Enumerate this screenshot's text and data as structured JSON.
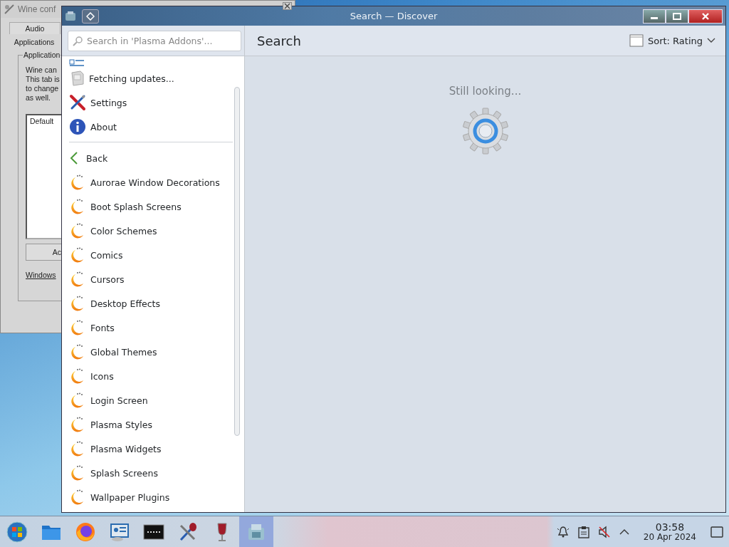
{
  "wine_window": {
    "title": "Wine conf",
    "tabs": [
      {
        "label": "Audio",
        "selected": false
      },
      {
        "label": "Applications",
        "selected": true
      }
    ],
    "group_title": "Application",
    "description": [
      "Wine can",
      "This tab is",
      "to change",
      "as well."
    ],
    "list_header": "Default",
    "button": "Ac",
    "version_label": "Windows"
  },
  "discover": {
    "title": "Search — Discover",
    "search": {
      "placeholder": "Search in 'Plasma Addons'..."
    },
    "heading": "Search",
    "sort": "Sort: Rating",
    "status": "Still looking...",
    "menu": [
      {
        "kind": "updates",
        "label": "Fetching updates..."
      },
      {
        "kind": "settings",
        "label": "Settings"
      },
      {
        "kind": "about",
        "label": "About"
      },
      {
        "kind": "back",
        "label": "Back"
      }
    ],
    "categories": [
      "Aurorae Window Decorations",
      "Boot Splash Screens",
      "Color Schemes",
      "Comics",
      "Cursors",
      "Desktop Effects",
      "Fonts",
      "Global Themes",
      "Icons",
      "Login Screen",
      "Plasma Styles",
      "Plasma Widgets",
      "Splash Screens",
      "Wallpaper Plugins"
    ]
  },
  "taskbar": {
    "tasks": [
      {
        "kind": "start",
        "selected": false
      },
      {
        "kind": "files",
        "selected": false
      },
      {
        "kind": "browser",
        "selected": false
      },
      {
        "kind": "monitor",
        "selected": false
      },
      {
        "kind": "terminal",
        "selected": false
      },
      {
        "kind": "wine-tools",
        "selected": false
      },
      {
        "kind": "wine",
        "selected": false
      },
      {
        "kind": "discover",
        "selected": true
      }
    ],
    "clock": {
      "time": "03:58",
      "date": "20 Apr 2024"
    }
  }
}
